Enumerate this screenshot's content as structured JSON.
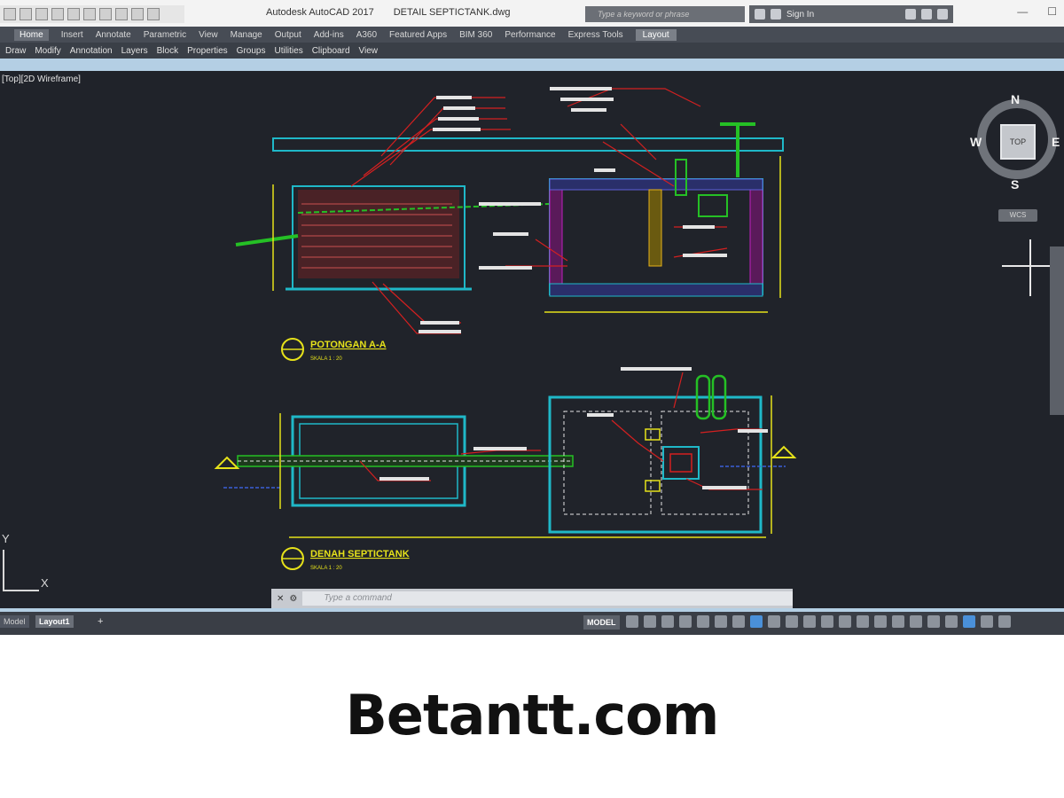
{
  "app": {
    "title": "Autodesk AutoCAD 2017",
    "filename": "DETAIL SEPTICTANK.dwg",
    "search_placeholder": "Type a keyword or phrase",
    "sign_in": "Sign In"
  },
  "ribbon": {
    "tabs": [
      "Home",
      "Insert",
      "Annotate",
      "Parametric",
      "View",
      "Manage",
      "Output",
      "Add-ins",
      "A360",
      "Featured Apps",
      "BIM 360",
      "Performance",
      "Express Tools",
      "Layout"
    ],
    "panels": [
      "Draw",
      "Modify",
      "Annotation",
      "Layers",
      "Block",
      "Properties",
      "Groups",
      "Utilities",
      "Clipboard",
      "View"
    ]
  },
  "viewport": {
    "label": "[Top][2D Wireframe]"
  },
  "viewcube": {
    "top": "TOP",
    "n": "N",
    "s": "S",
    "e": "E",
    "w": "W",
    "wcs": "WCS"
  },
  "ucs": {
    "x": "X",
    "y": "Y"
  },
  "drawing": {
    "section_title": "POTONGAN A-A",
    "section_scale": "SKALA 1 : 20",
    "plan_title": "DENAH SEPTICTANK",
    "plan_scale": "SKALA 1 : 20"
  },
  "command": {
    "placeholder": "Type a command"
  },
  "layout_tabs": {
    "model": "Model",
    "layout1": "Layout1",
    "add": "+"
  },
  "status": {
    "model": "MODEL"
  },
  "caption": "Betantt.com",
  "colors": {
    "canvas": "#20232a",
    "cyan": "#1fb8c8",
    "red": "#d42020",
    "yellow": "#e6e21a",
    "green": "#25c025",
    "magenta": "#c020c0"
  }
}
